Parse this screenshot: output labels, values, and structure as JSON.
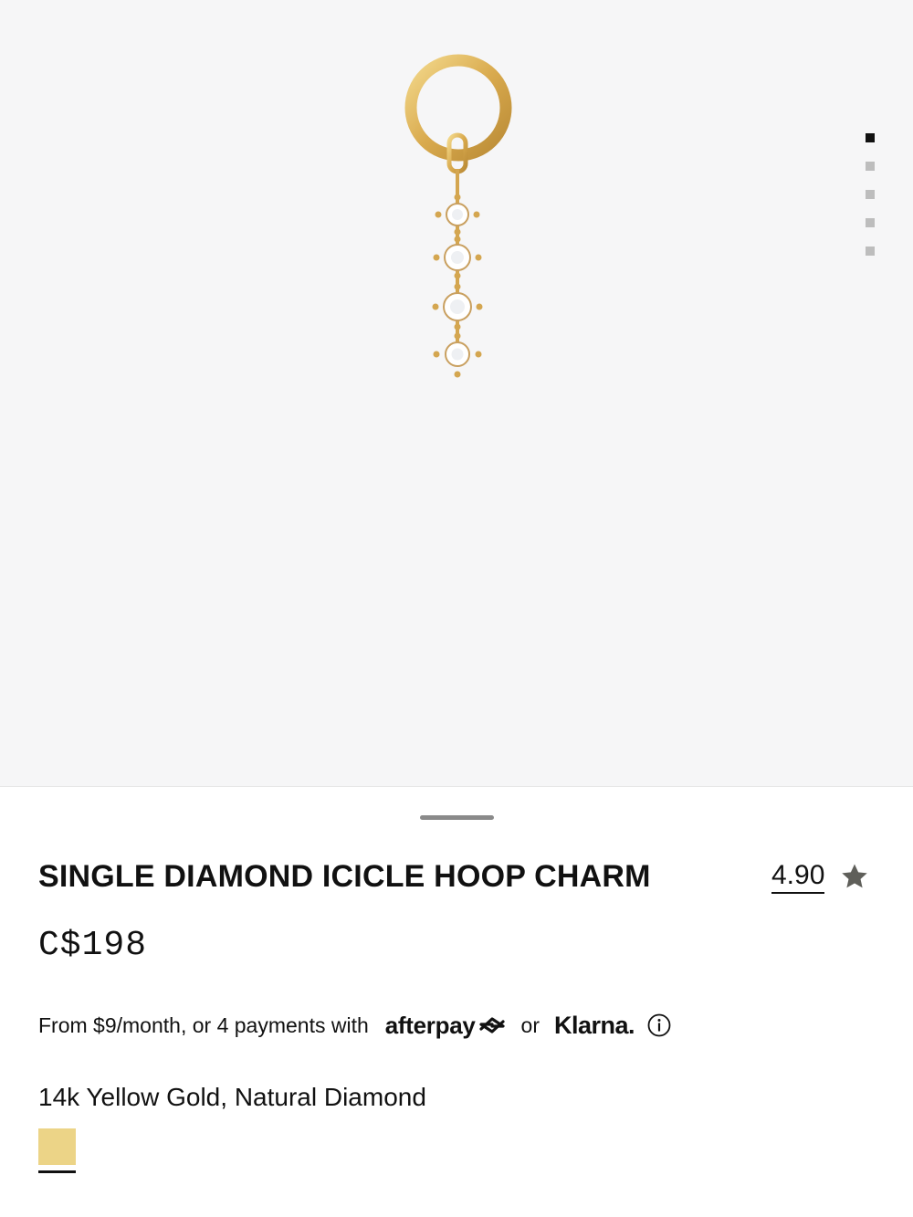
{
  "gallery": {
    "image_alt": "Single Diamond Icicle Hoop Charm in 14k yellow gold",
    "dot_count": 5,
    "active_index": 0,
    "background": "#f6f6f7"
  },
  "product": {
    "title": "SINGLE DIAMOND ICICLE HOOP CHARM",
    "rating": "4.90",
    "rating_icon": "star-icon",
    "price": "C$198"
  },
  "payments": {
    "text": "From $9/month, or 4 payments with",
    "afterpay_label": "afterpay",
    "or_label": "or",
    "klarna_label": "Klarna.",
    "info_icon": "info-icon"
  },
  "variant": {
    "label": "14k Yellow Gold, Natural Diamond",
    "swatch_color": "#ecd487"
  }
}
